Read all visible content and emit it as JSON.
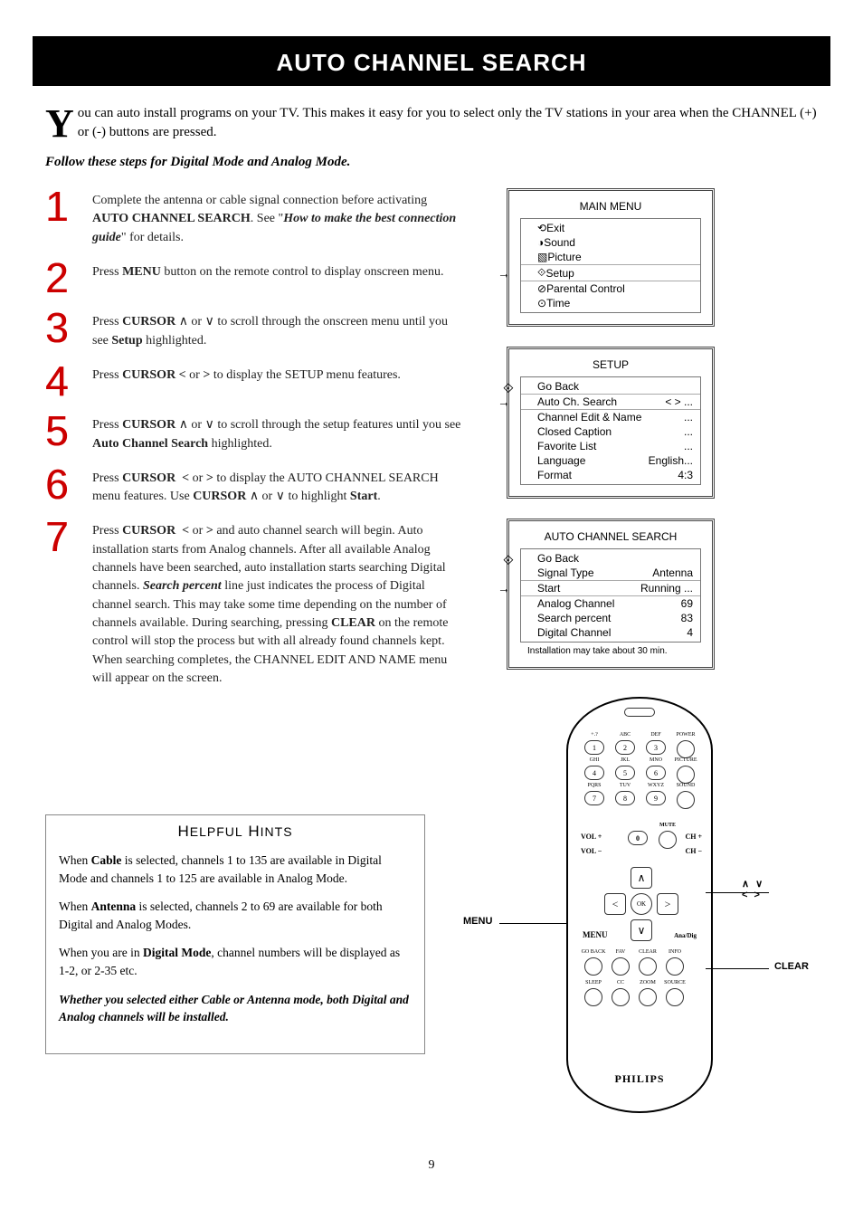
{
  "title": "AUTO CHANNEL SEARCH",
  "intro_dropcap": "Y",
  "intro_text": "ou can auto install programs on your TV.  This makes it easy for you to select only the TV stations in your area when the CHANNEL (+) or (-) buttons are pressed.",
  "subhead": "Follow these steps for Digital Mode and Analog Mode.",
  "steps": [
    {
      "num": "1",
      "html": "Complete the antenna or cable signal connection before activating <b>AUTO CHANNEL SEARCH</b>. See \"<b><i>How to make the best connection guide</i></b>\" for details."
    },
    {
      "num": "2",
      "html": "Press <b>MENU</b> button on the remote control to display onscreen menu."
    },
    {
      "num": "3",
      "html": "Press <b>CURSOR</b> ∧ or ∨ to scroll through the onscreen menu until you see <b>Setup</b> highlighted."
    },
    {
      "num": "4",
      "html": "Press <b>CURSOR &lt;</b> or <b>&gt;</b> to display the SETUP menu features."
    },
    {
      "num": "5",
      "html": "Press <b>CURSOR</b> ∧ or ∨ to scroll through the setup features until you see <b>Auto Channel Search</b> highlighted."
    },
    {
      "num": "6",
      "html": "Press <b>CURSOR &nbsp;&lt;</b> or <b>&gt;</b> to display the AUTO CHANNEL SEARCH menu features. Use <b>CURSOR</b> ∧ or ∨ to highlight <b>Start</b>."
    },
    {
      "num": "7",
      "html": "Press <b>CURSOR &nbsp;&lt;</b> or <b>&gt;</b> and auto channel search will begin. Auto installation starts from Analog channels. After all available Analog channels have been searched, auto installation starts searching Digital channels. <b><i>Search percent</i></b> line just indicates the process of Digital channel search. This may take some time depending on the number of channels available. During searching, pressing <b>CLEAR</b> on the remote control will stop the process but with all already found channels kept. When searching completes, the CHANNEL EDIT AND NAME menu will appear on the screen."
    }
  ],
  "hints_title": "HELPFUL HINTS",
  "hints": [
    "When <b>Cable</b> is selected, channels 1 to 135 are available in Digital Mode and channels 1 to 125 are available in Analog Mode.",
    "When <b>Antenna</b> is selected, channels 2 to 69 are available for both Digital and Analog Modes.",
    "When you are in <b>Digital Mode</b>, channel numbers will be displayed as 1-2, or 2-35 etc.",
    "<b><i>Whether you selected either Cable or Antenna mode, both Digital and Analog channels will be installed.</i></b>"
  ],
  "osd_main": {
    "title": "MAIN MENU",
    "rows": [
      {
        "icon": "⟲",
        "label": "Exit"
      },
      {
        "icon": "◑",
        "label": "Sound"
      },
      {
        "icon": "▧",
        "label": "Picture"
      },
      {
        "icon": "⟐",
        "label": "Setup",
        "selected": true
      },
      {
        "icon": "⊘",
        "label": "Parental Control"
      },
      {
        "icon": "⊙",
        "label": "Time"
      }
    ]
  },
  "osd_setup": {
    "title": "SETUP",
    "icon": "⟐",
    "rows": [
      {
        "label": "Go Back",
        "val": ""
      },
      {
        "label": "Auto Ch. Search",
        "val": "< > ...",
        "selected": true
      },
      {
        "label": "Channel Edit & Name",
        "val": "..."
      },
      {
        "label": "Closed Caption",
        "val": "..."
      },
      {
        "label": "Favorite List",
        "val": "..."
      },
      {
        "label": "Language",
        "val": "English..."
      },
      {
        "label": "Format",
        "val": "4:3"
      }
    ]
  },
  "osd_acs": {
    "title": "AUTO CHANNEL SEARCH",
    "icon": "⟐",
    "rows": [
      {
        "label": "Go Back",
        "val": ""
      },
      {
        "label": "Signal Type",
        "val": "Antenna"
      },
      {
        "label": "Start",
        "val": "Running ...",
        "selected": true
      },
      {
        "label": "Analog Channel",
        "val": "69"
      },
      {
        "label": "Search percent",
        "val": "83"
      },
      {
        "label": "Digital Channel",
        "val": "4"
      }
    ],
    "note": "Installation may take about 30 min."
  },
  "remote": {
    "brand": "PHILIPS",
    "keypad_top": [
      {
        "n": "1",
        "t": "+.?"
      },
      {
        "n": "2",
        "t": "ABC"
      },
      {
        "n": "3",
        "t": "DEF"
      },
      {
        "n": "",
        "t": "POWER"
      },
      {
        "n": "4",
        "t": "GHI"
      },
      {
        "n": "5",
        "t": "JKL"
      },
      {
        "n": "6",
        "t": "MNO"
      },
      {
        "n": "",
        "t": "PICTURE"
      },
      {
        "n": "7",
        "t": "PQRS"
      },
      {
        "n": "8",
        "t": "TUV"
      },
      {
        "n": "9",
        "t": "WXYZ"
      },
      {
        "n": "",
        "t": "SOUND"
      }
    ],
    "zero_row": {
      "left": "VOL +",
      "mid_left": "",
      "zero": "0",
      "mute": "MUTE",
      "right": "CH +"
    },
    "vol_minus": "VOL −",
    "ch_minus": "CH −",
    "ok": "OK",
    "row_a": [
      "GO BACK",
      "FAV",
      "CLEAR",
      "INFO"
    ],
    "row_b": [
      "SLEEP",
      "CC",
      "ZOOM",
      "SOURCE"
    ],
    "menu_label": "MENU",
    "anadig_label": "Ana/Dig"
  },
  "leads": {
    "menu": "MENU",
    "cursor": "∧ ∨ < >",
    "clear": "CLEAR"
  },
  "page_number": "9"
}
